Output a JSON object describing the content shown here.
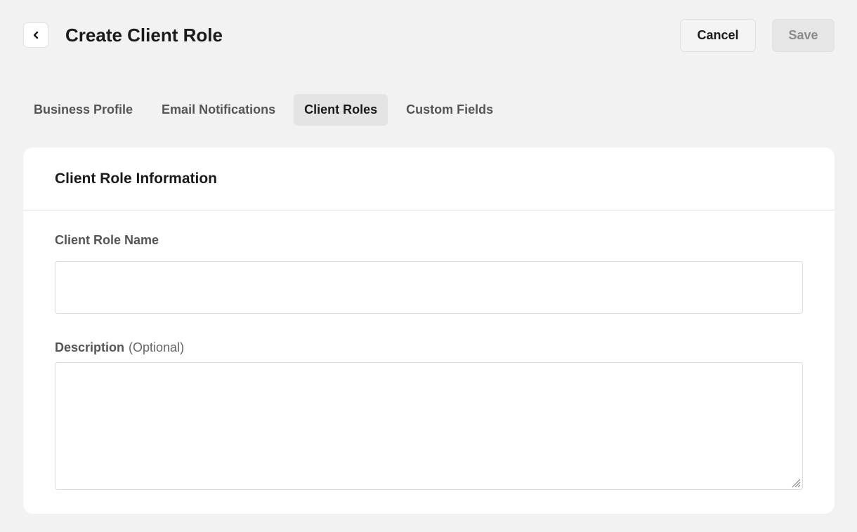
{
  "header": {
    "title": "Create Client Role",
    "back_icon": "chevron-left-icon",
    "cancel_label": "Cancel",
    "save_label": "Save"
  },
  "tabs": [
    {
      "label": "Business Profile",
      "active": false
    },
    {
      "label": "Email Notifications",
      "active": false
    },
    {
      "label": "Client Roles",
      "active": true
    },
    {
      "label": "Custom Fields",
      "active": false
    }
  ],
  "card": {
    "title": "Client Role Information",
    "fields": {
      "name": {
        "label": "Client Role Name",
        "value": "",
        "placeholder": ""
      },
      "description": {
        "label": "Description",
        "optional": "(Optional)",
        "value": "",
        "placeholder": ""
      }
    }
  },
  "colors": {
    "background": "#f2f2f2",
    "card": "#ffffff",
    "active_tab": "#e4e4e4",
    "disabled_button": "#e6e6e6"
  }
}
